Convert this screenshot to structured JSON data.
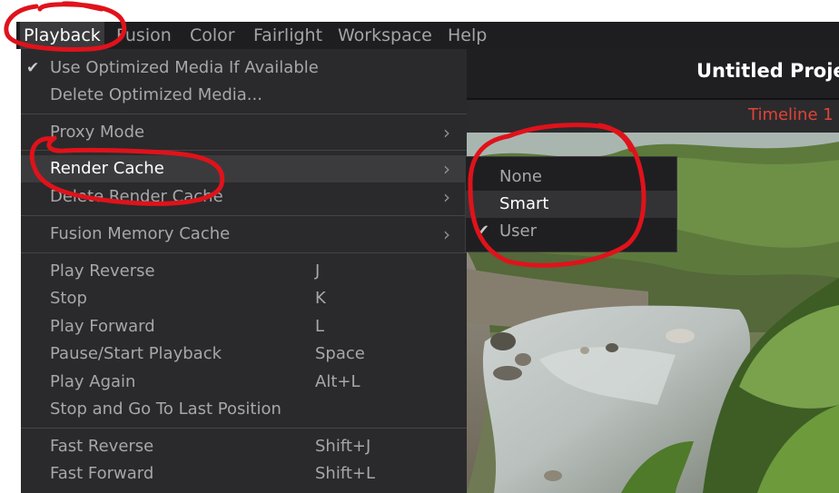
{
  "menubar": {
    "items": [
      "Playback",
      "Fusion",
      "Color",
      "Fairlight",
      "Workspace",
      "Help"
    ]
  },
  "header": {
    "project_title": "Untitled Projec",
    "timeline_name": "Timeline 1"
  },
  "playback_menu": {
    "items": [
      {
        "label": "Use Optimized Media If Available",
        "checked": true
      },
      {
        "label": "Delete Optimized Media..."
      },
      {
        "label": "Proxy Mode",
        "submenu": true
      },
      {
        "label": "Render Cache",
        "submenu": true,
        "highlighted": true
      },
      {
        "label": "Delete Render Cache",
        "submenu": true
      },
      {
        "label": "Fusion Memory Cache",
        "submenu": true
      },
      {
        "label": "Play Reverse",
        "shortcut": "J"
      },
      {
        "label": "Stop",
        "shortcut": "K"
      },
      {
        "label": "Play Forward",
        "shortcut": "L"
      },
      {
        "label": "Pause/Start Playback",
        "shortcut": "Space"
      },
      {
        "label": "Play Again",
        "shortcut": "Alt+L"
      },
      {
        "label": "Stop and Go To Last Position"
      },
      {
        "label": "Fast Reverse",
        "shortcut": "Shift+J"
      },
      {
        "label": "Fast Forward",
        "shortcut": "Shift+L"
      }
    ]
  },
  "render_cache_submenu": {
    "items": [
      {
        "label": "None"
      },
      {
        "label": "Smart",
        "highlighted": true
      },
      {
        "label": "User",
        "checked": true
      }
    ]
  },
  "icons": {
    "check": "checkmark-icon",
    "submenu": "chevron-right-icon"
  },
  "colors": {
    "menu_bg": "#2a2a2c",
    "highlight": "#3b3b3d",
    "timeline_accent": "#e14338",
    "annotation": "#e0121b"
  }
}
